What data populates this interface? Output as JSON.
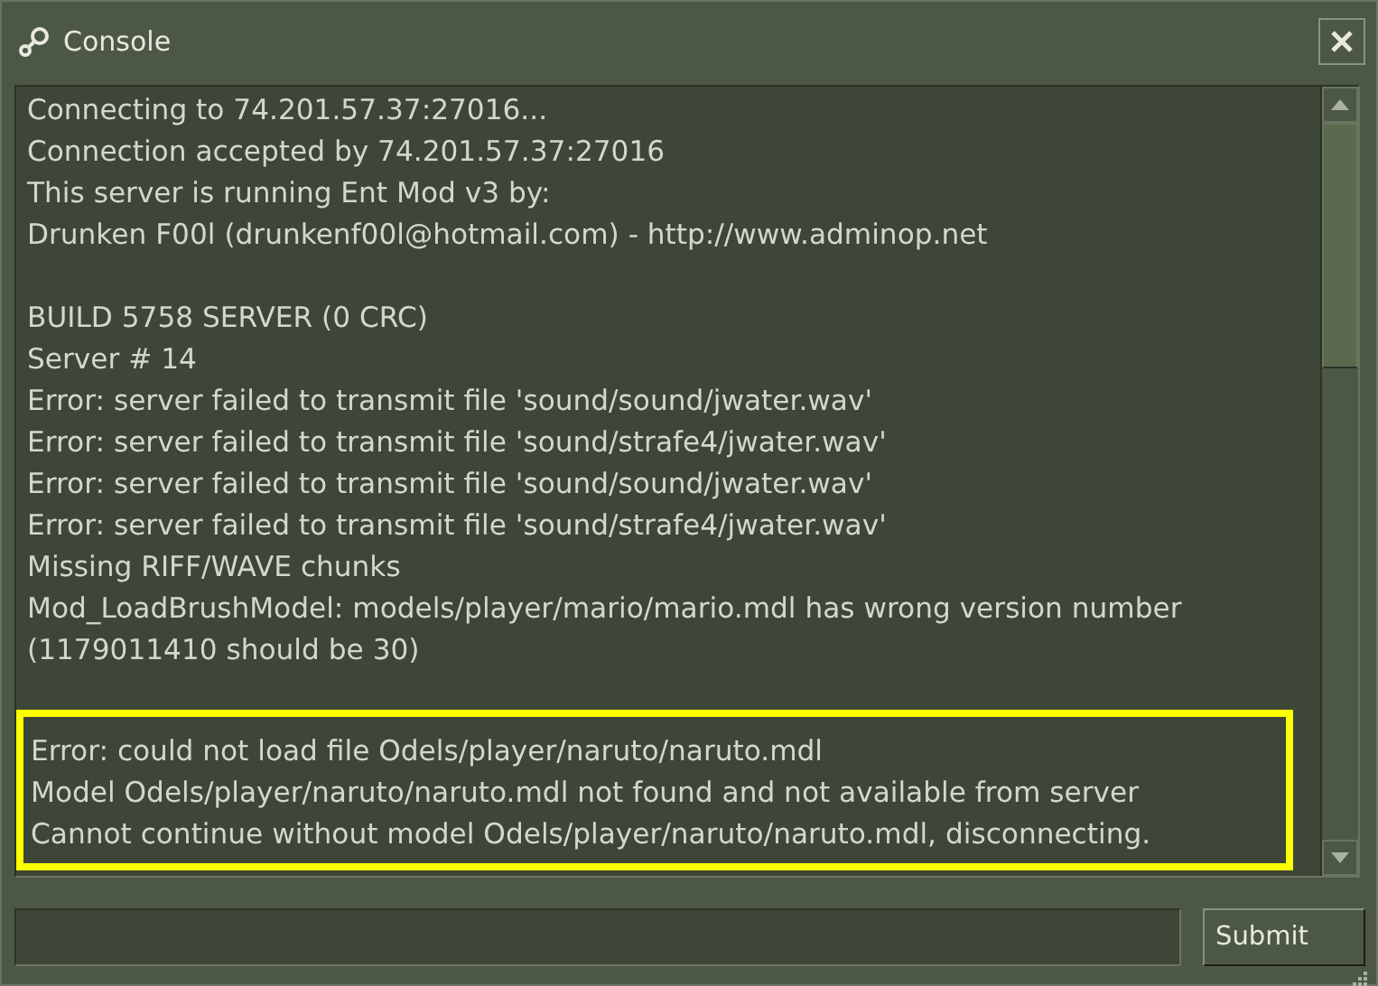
{
  "window": {
    "title": "Console"
  },
  "log_blocks": [
    {
      "highlighted": false,
      "lines": [
        "Connecting to 74.201.57.37:27016...",
        "Connection accepted by 74.201.57.37:27016",
        "This server is running Ent Mod v3 by:",
        "Drunken F00l (drunkenf00l@hotmail.com) - http://www.adminop.net"
      ]
    },
    {
      "highlighted": false,
      "lines": [
        "BUILD 5758 SERVER (0 CRC)",
        "Server # 14",
        "Error: server failed to transmit file 'sound/sound/jwater.wav'",
        "Error: server failed to transmit file 'sound/strafe4/jwater.wav'",
        "Error: server failed to transmit file 'sound/sound/jwater.wav'",
        "Error: server failed to transmit file 'sound/strafe4/jwater.wav'",
        "Missing RIFF/WAVE chunks",
        "Mod_LoadBrushModel: models/player/mario/mario.mdl has wrong version number",
        "(1179011410 should be 30)"
      ]
    },
    {
      "highlighted": true,
      "lines": [
        "Error: could not load file Odels/player/naruto/naruto.mdl",
        "Model Odels/player/naruto/naruto.mdl not found and not available from server",
        "Cannot continue without model Odels/player/naruto/naruto.mdl, disconnecting."
      ]
    }
  ],
  "submit_button": "Submit"
}
